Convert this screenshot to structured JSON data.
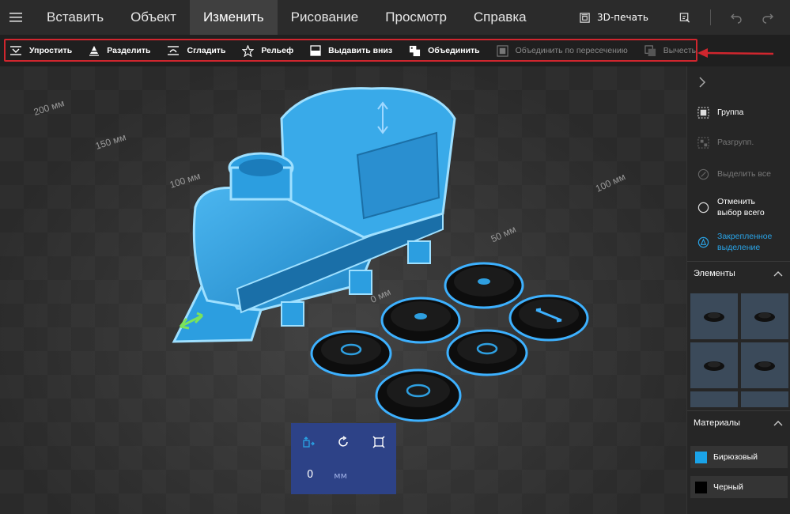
{
  "menu": {
    "tabs": [
      {
        "label": "Вставить"
      },
      {
        "label": "Объект"
      },
      {
        "label": "Изменить"
      },
      {
        "label": "Рисование"
      },
      {
        "label": "Просмотр"
      },
      {
        "label": "Справка"
      }
    ],
    "active_tab": "Изменить",
    "print3d_label": "3D-печать"
  },
  "toolbar": {
    "tools": [
      {
        "label": "Упростить",
        "icon": "simplify-icon",
        "enabled": true
      },
      {
        "label": "Разделить",
        "icon": "split-icon",
        "enabled": true
      },
      {
        "label": "Сгладить",
        "icon": "smooth-icon",
        "enabled": true
      },
      {
        "label": "Рельеф",
        "icon": "star-icon",
        "enabled": true
      },
      {
        "label": "Выдавить вниз",
        "icon": "extrude-down-icon",
        "enabled": true
      },
      {
        "label": "Объединить",
        "icon": "merge-icon",
        "enabled": true
      },
      {
        "label": "Объединить по пересечению",
        "icon": "intersect-icon",
        "enabled": false
      },
      {
        "label": "Вычесть",
        "icon": "subtract-icon",
        "enabled": false
      }
    ]
  },
  "viewport": {
    "ruler_labels": [
      "200 мм",
      "150 мм",
      "100 мм",
      "50 мм",
      "0 мм",
      "100 мм"
    ]
  },
  "transform": {
    "value": "0",
    "unit": "мм"
  },
  "right_panel": {
    "actions": [
      {
        "label": "Группа",
        "state": "enabled"
      },
      {
        "label": "Разгрупп.",
        "state": "disabled"
      },
      {
        "label": "Выделить все",
        "state": "disabled"
      },
      {
        "label": "Отменить выбор всего",
        "state": "enabled"
      },
      {
        "label": "Закрепленное выделение",
        "state": "accent"
      }
    ],
    "elements_title": "Элементы",
    "materials_title": "Материалы",
    "materials": [
      {
        "label": "Бирюзовый",
        "color": "#1aa3e8"
      },
      {
        "label": "Черный",
        "color": "#000000"
      }
    ]
  },
  "colors": {
    "accent": "#29a3e6",
    "highlight_frame": "#d0262e",
    "model_blue": "#2e9fe0"
  }
}
